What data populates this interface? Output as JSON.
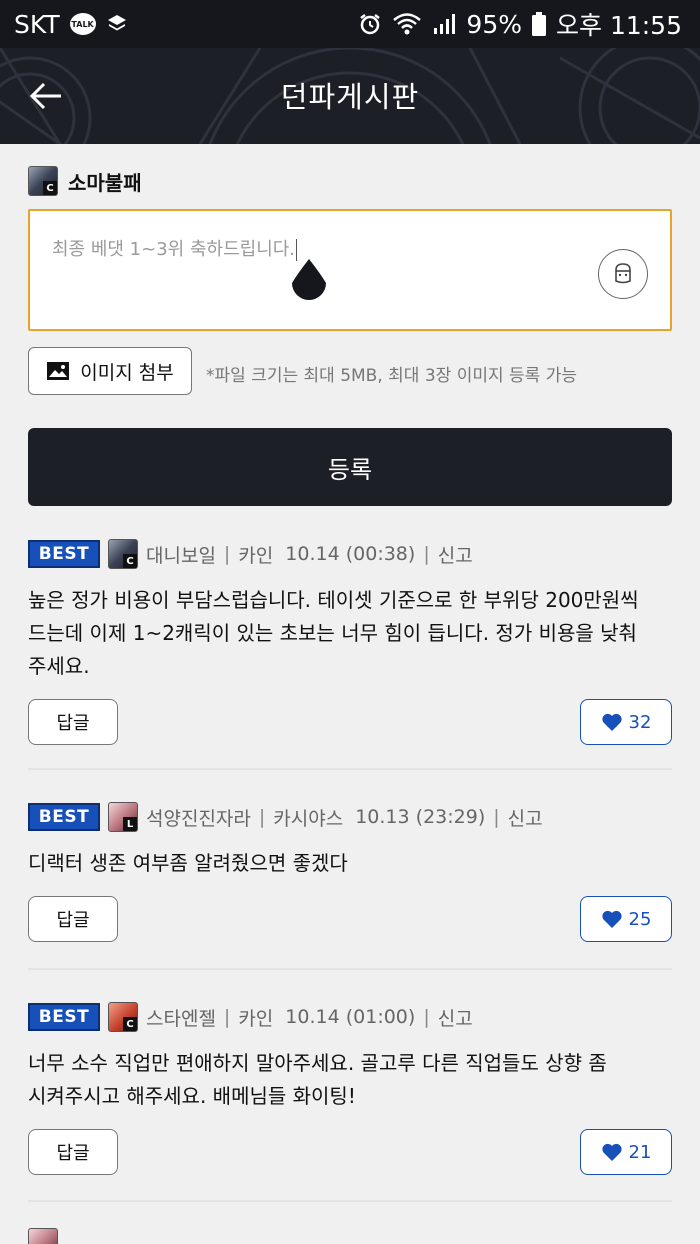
{
  "status_bar": {
    "carrier": "SKT",
    "talk_badge": "TALK",
    "battery": "95%",
    "time": "오후 11:55"
  },
  "header": {
    "title": "던파게시판",
    "back_icon": "arrow-left-icon"
  },
  "composer": {
    "author_name": "소마불패",
    "author_class_badge": "C",
    "text": "최종 베댓 1~3위 축하드립니다.",
    "emoji_icon": "emoticon-icon",
    "attach_label": "이미지 첨부",
    "attach_note": "*파일 크기는 최대 5MB, 최대 3장 이미지 등록 가능",
    "submit_label": "등록"
  },
  "colors": {
    "accent_blue": "#1650b8",
    "focus_border": "#e6a52a",
    "dark": "#1d1f26"
  },
  "comments": [
    {
      "badge": "BEST",
      "class_badge": "C",
      "author": "대니보일",
      "job": "카인",
      "date": "10.14 (00:38)",
      "report": "신고",
      "body": "높은 정가 비용이 부담스럽습니다. 테이셋 기준으로 한 부위당 200만원씩 드는데 이제 1~2캐릭이 있는 초보는 너무 힘이 듭니다. 정가 비용을 낮춰 주세요.",
      "reply": "답글",
      "likes": "32"
    },
    {
      "badge": "BEST",
      "class_badge": "L",
      "author": "석양진진자라",
      "job": "카시야스",
      "date": "10.13 (23:29)",
      "report": "신고",
      "body": "디랙터 생존 여부좀 알려줬으면 좋겠다",
      "reply": "답글",
      "likes": "25"
    },
    {
      "badge": "BEST",
      "class_badge": "C",
      "author": "스타엔젤",
      "job": "카인",
      "date": "10.14 (01:00)",
      "report": "신고",
      "body": "너무 소수 직업만 편애하지 말아주세요. 골고루 다른 직업들도 상향 좀 시켜주시고 해주세요. 배메님들 화이팅!",
      "reply": "답글",
      "likes": "21"
    }
  ]
}
